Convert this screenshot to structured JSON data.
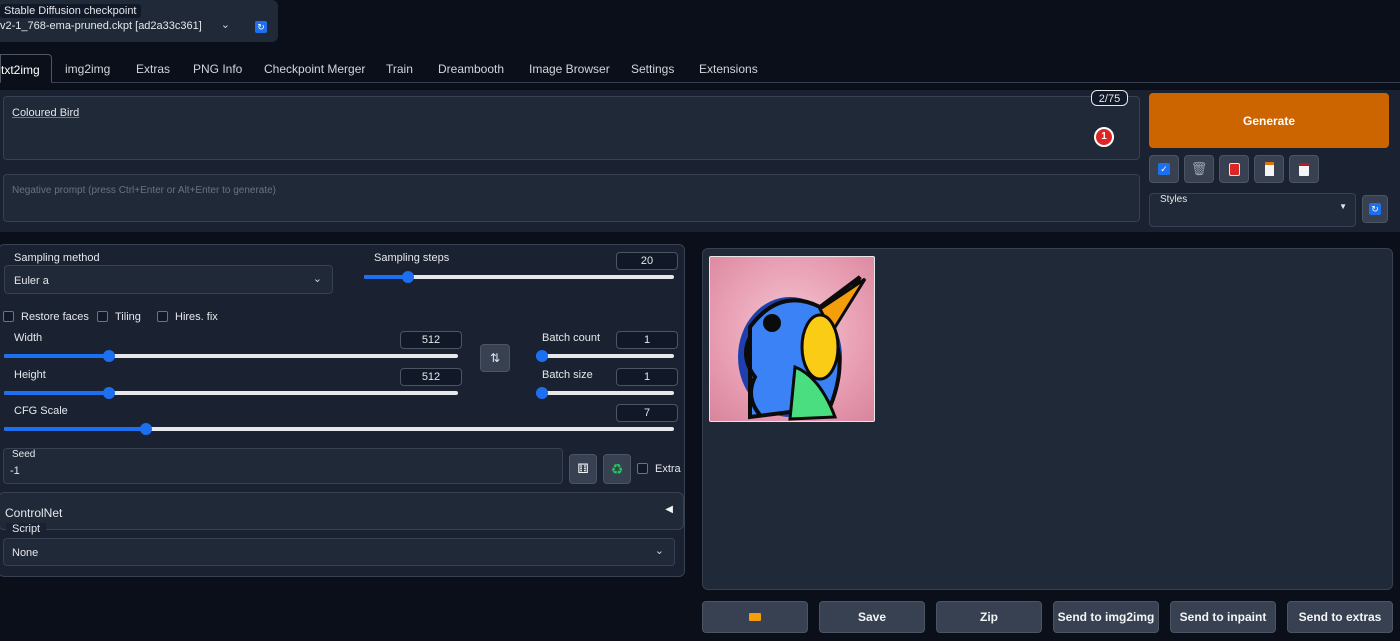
{
  "checkpoint": {
    "label": "Stable Diffusion checkpoint",
    "value": "v2-1_768-ema-pruned.ckpt [ad2a33c361]",
    "refresh_icon": "refresh-icon"
  },
  "tabs": [
    "txt2img",
    "img2img",
    "Extras",
    "PNG Info",
    "Checkpoint Merger",
    "Train",
    "Dreambooth",
    "Image Browser",
    "Settings",
    "Extensions"
  ],
  "prompt": {
    "value": "Coloured Bird",
    "token_count": "2/75",
    "error_badge": "1",
    "negative_placeholder": "Negative prompt (press Ctrl+Enter or Alt+Enter to generate)"
  },
  "generate": {
    "label": "Generate",
    "color": "#cc6400"
  },
  "tools": {
    "icons": [
      "checkbox-icon",
      "trash-icon",
      "paint-icon",
      "clipboard-icon",
      "save-icon"
    ]
  },
  "styles": {
    "label": "Styles",
    "value": ""
  },
  "params": {
    "sampling_method_label": "Sampling method",
    "sampling_method": "Euler a",
    "sampling_steps_label": "Sampling steps",
    "sampling_steps": "20",
    "restore_faces": "Restore faces",
    "tiling": "Tiling",
    "hires_fix": "Hires. fix",
    "width_label": "Width",
    "width": "512",
    "height_label": "Height",
    "height": "512",
    "batch_count_label": "Batch count",
    "batch_count": "1",
    "batch_size_label": "Batch size",
    "batch_size": "1",
    "cfg_label": "CFG Scale",
    "cfg": "7",
    "seed_label": "Seed",
    "seed": "-1",
    "extra": "Extra"
  },
  "controlnet": {
    "label": "ControlNet"
  },
  "script": {
    "label": "Script",
    "value": "None"
  },
  "output_buttons": {
    "folder_icon": "folder-icon",
    "save": "Save",
    "zip": "Zip",
    "send_img2img": "Send to img2img",
    "send_inpaint": "Send to inpaint",
    "send_extras": "Send to extras"
  },
  "colors": {
    "background": "#0b0f19",
    "panel": "#1f2937",
    "accent": "#1d6ff2"
  }
}
